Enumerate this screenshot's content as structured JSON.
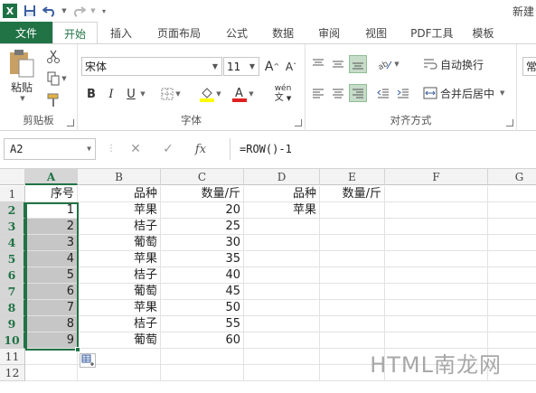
{
  "window": {
    "title_partial": "新建"
  },
  "tabs": [
    "文件",
    "开始",
    "插入",
    "页面布局",
    "公式",
    "数据",
    "审阅",
    "视图",
    "PDF工具",
    "模板"
  ],
  "active_tab": "开始",
  "ribbon": {
    "clipboard": {
      "paste_label": "粘贴",
      "group_label": "剪贴板"
    },
    "font": {
      "font_name": "宋体",
      "font_size": "11",
      "group_label": "字体",
      "bold": "B",
      "italic": "I",
      "underline": "U",
      "phonetic": "wén"
    },
    "alignment": {
      "wrap_text": "自动换行",
      "merge_center": "合并后居中",
      "group_label": "对齐方式"
    },
    "number": {
      "format_partial": "常"
    }
  },
  "formula_bar": {
    "name_box": "A2",
    "cancel": "✕",
    "enter": "✓",
    "fx": "fx",
    "formula": "=ROW()-1"
  },
  "columns": [
    "A",
    "B",
    "C",
    "D",
    "E",
    "F",
    "G"
  ],
  "rows": [
    "1",
    "2",
    "3",
    "4",
    "5",
    "6",
    "7",
    "8",
    "9",
    "10",
    "11",
    "12"
  ],
  "cells": {
    "headers": {
      "A1": "序号",
      "B1": "品种",
      "C1": "数量/斤",
      "D1": "品种",
      "E1": "数量/斤"
    },
    "A": [
      "1",
      "2",
      "3",
      "4",
      "5",
      "6",
      "7",
      "8",
      "9"
    ],
    "B": [
      "苹果",
      "桔子",
      "葡萄",
      "苹果",
      "桔子",
      "葡萄",
      "苹果",
      "桔子",
      "葡萄"
    ],
    "C": [
      "20",
      "25",
      "30",
      "35",
      "40",
      "45",
      "50",
      "55",
      "60"
    ],
    "D2": "苹果"
  },
  "watermark": "HTML南龙网",
  "colors": {
    "excel_green": "#217346",
    "selection_gray": "#c6c6c6"
  }
}
